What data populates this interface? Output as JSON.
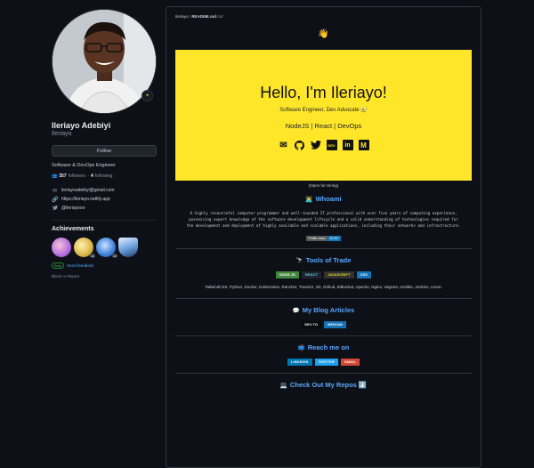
{
  "profile": {
    "name": "Ileriayo Adebiyi",
    "login": "Ileriayo",
    "follow_label": "Follow",
    "bio": "Software & DevOps Engineer",
    "followers_count": "357",
    "followers_label": "followers",
    "following_count": "4",
    "following_label": "following",
    "email": "ileriayoadebiyi@gmail.com",
    "website": "https://ileriayo.netlify.app",
    "twitter": "@ileriayooo",
    "achievements_title": "Achievements",
    "badge_counts": [
      "x4",
      "x3"
    ],
    "beta_label": "Beta",
    "feedback_label": "Send feedback",
    "block_label": "Block or Report"
  },
  "readme": {
    "header_user": "Ileriayo",
    "header_sep": "/",
    "header_file": "README.md",
    "wave": "👋",
    "hero_title": "Hello, I'm Ileriayo!",
    "hero_subtitle": "Software Engineer, Dev Advocate 🥑",
    "hero_stack": "NodeJS | React | DevOps",
    "hero_icons": [
      "mail-icon",
      "github-icon",
      "twitter-icon",
      "devto-icon",
      "linkedin-icon",
      "medium-icon"
    ],
    "devto_text": "DEV",
    "linkedin_text": "in",
    "medium_text": "M",
    "hiring": "(Open for Hiring)",
    "whoami_emoji": "👨‍💻",
    "whoami_title": "Whoami",
    "whoami_text": "A highly resourceful computer programmer and well-rounded IT professional with over five years of computing experience, possessing expert knowledge of the software development lifecycle and a valid understanding of technologies required for the development and deployment of highly available and scalable applications, including their networks and infrastructure.",
    "views_label": "Profile views",
    "views_count": "45,597",
    "tools_emoji": "🔭",
    "tools_title": "Tools of Trade",
    "tool_shields": [
      {
        "label": "NODE.JS",
        "color": "#43853d"
      },
      {
        "label": "REACT",
        "color": "#20232a"
      },
      {
        "label": "JAVASCRIPT",
        "color": "#323330"
      },
      {
        "label": "CSS",
        "color": "#1572b6"
      }
    ],
    "tools_text": "TailwindCSS, Python, Docker, Kubernetes, Rancher, TravisCI, Git, Github, Bitbucket, Apache, Nginx, Vagrant, Ansible, Jenkins, Azure.",
    "blog_emoji": "💬",
    "blog_title": "My Blog Articles",
    "blog_shields": [
      {
        "label": "DEV.TO",
        "color": "#0a0a0a"
      },
      {
        "label": "MEDIUM",
        "color": "#12100e"
      }
    ],
    "reach_emoji": "📫",
    "reach_title": "Reach me on",
    "reach_shields": [
      {
        "label": "LINKEDIN",
        "color": "#0077b5"
      },
      {
        "label": "TWITTER",
        "color": "#1da1f2"
      },
      {
        "label": "GMAIL",
        "color": "#d14836"
      }
    ],
    "repos_emoji": "💻",
    "repos_title": "Check Out My Repos ⬇️"
  }
}
